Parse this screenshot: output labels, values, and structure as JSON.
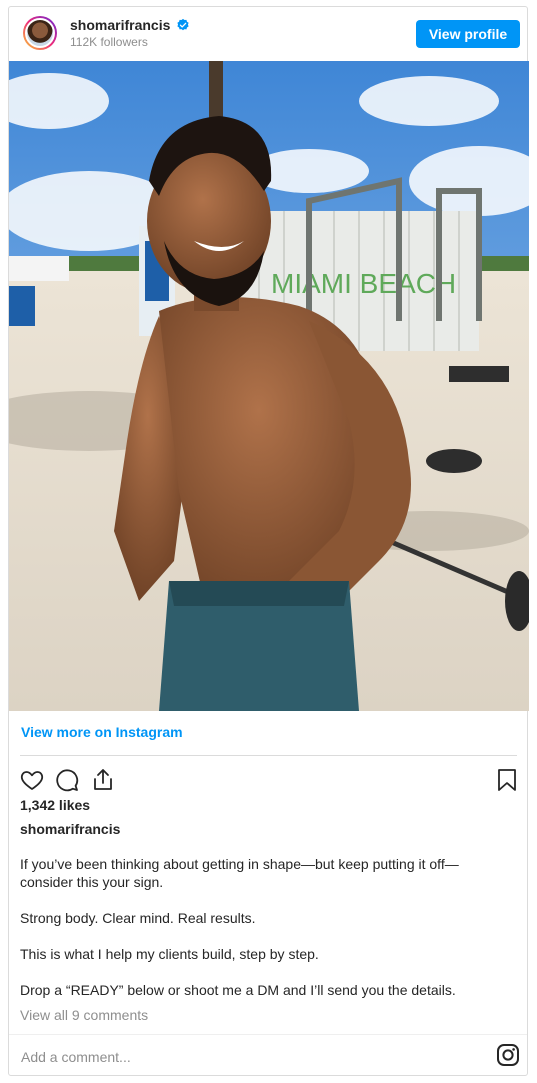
{
  "header": {
    "username": "shomarifrancis",
    "followers": "112K followers",
    "view_profile_label": "View profile"
  },
  "post": {
    "view_more_label": "View more on Instagram",
    "likes": "1,342 likes",
    "author": "shomarifrancis",
    "caption": [
      "If you’ve been thinking about getting in shape—but keep putting it off—consider this your sign.",
      "Strong body. Clear mind. Real results.",
      "This is what I help my clients build, step by step.",
      "Drop a “READY” below or shoot me a DM and I’ll send you the details."
    ],
    "view_comments": "View all 9 comments",
    "photo_sign_text": "MIAMI BEACH"
  },
  "comment": {
    "placeholder": "Add a comment..."
  },
  "icons": {
    "verified": "verified-badge-icon",
    "like": "heart-icon",
    "comment": "comment-bubble-icon",
    "share": "share-icon",
    "save": "bookmark-icon",
    "instagram": "instagram-logo-icon"
  },
  "colors": {
    "accent": "#0095f6",
    "border": "#dbdbdb",
    "muted": "#8e8e8e",
    "text": "#262626"
  }
}
